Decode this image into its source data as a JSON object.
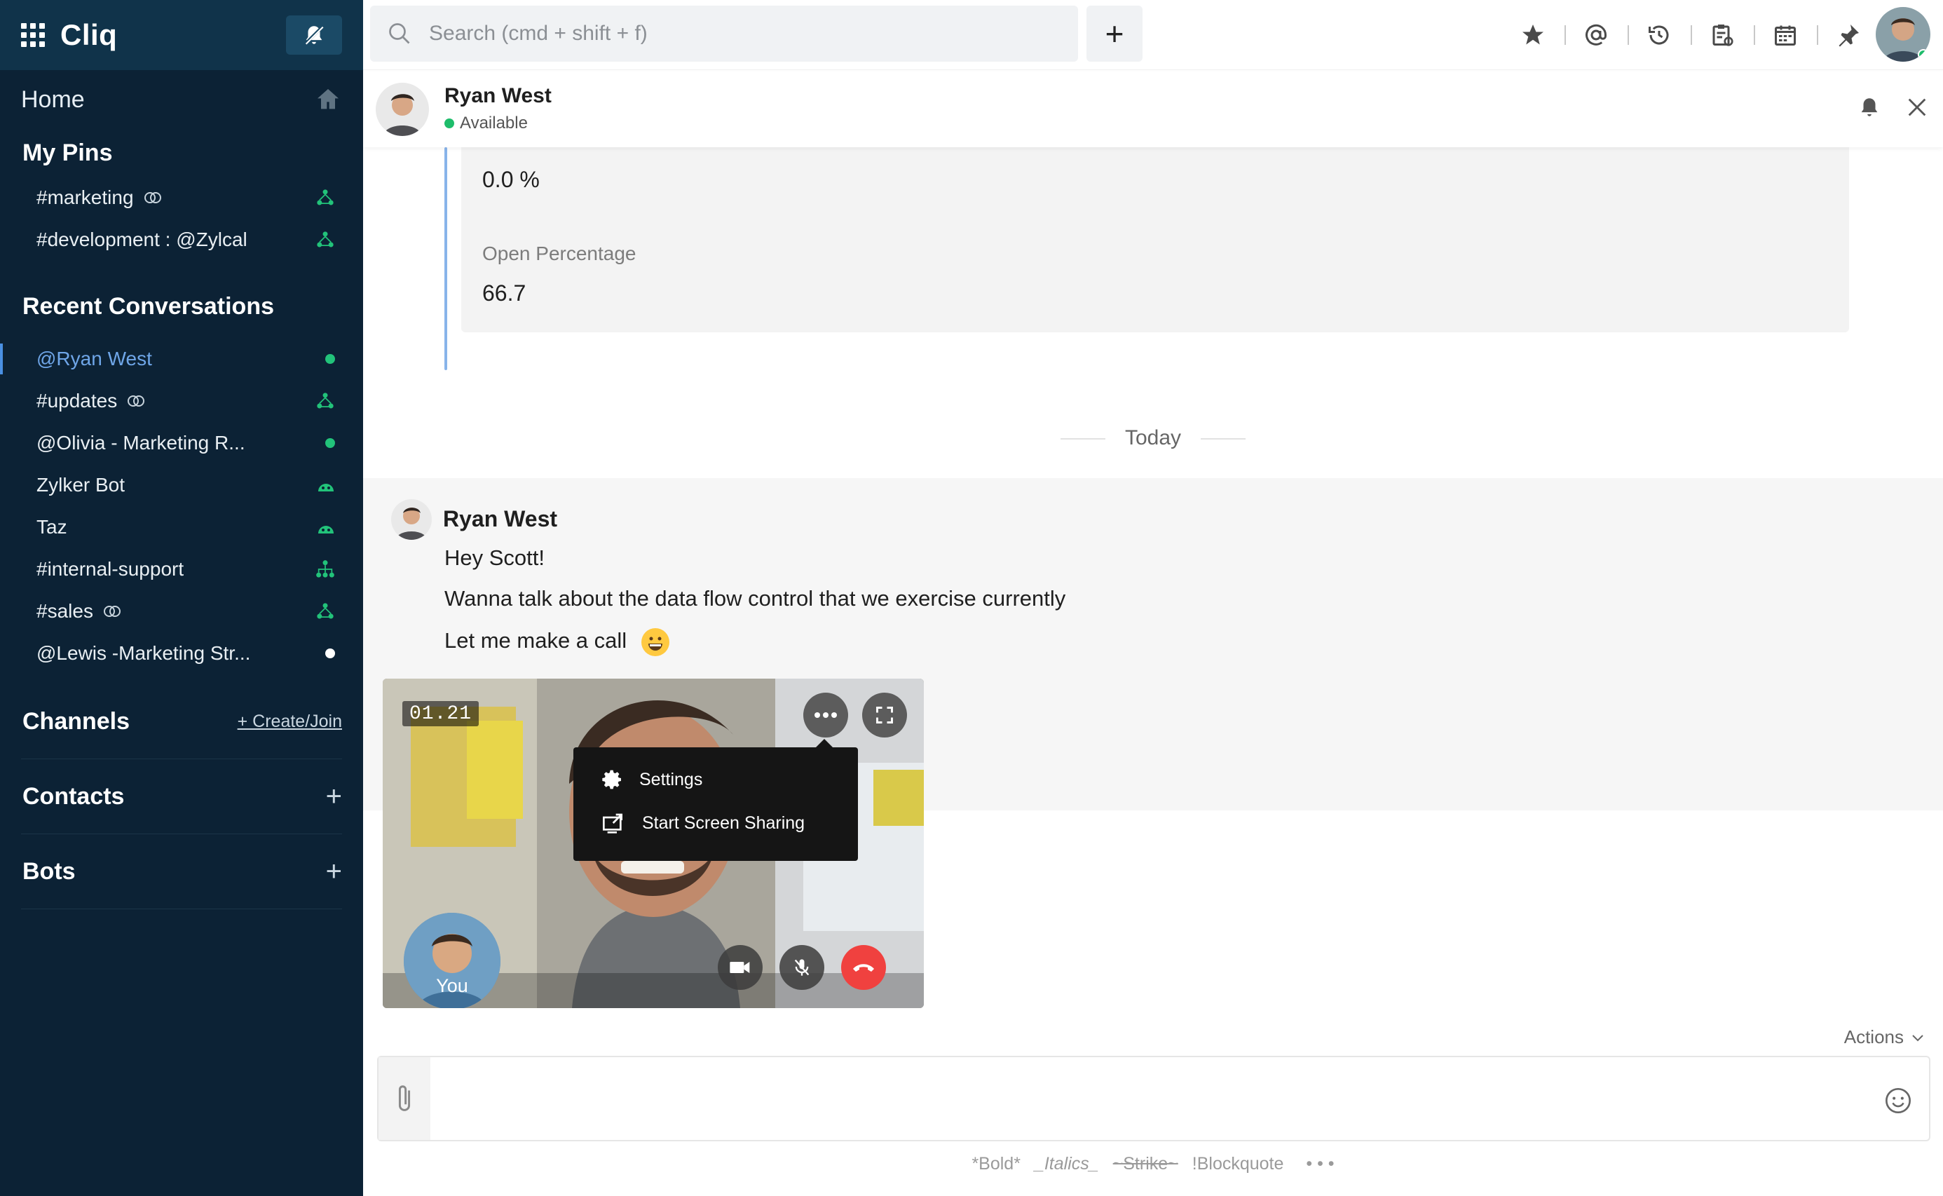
{
  "app": {
    "title": "Cliq"
  },
  "sidebar": {
    "home_label": "Home",
    "pins_title": "My Pins",
    "pins": [
      {
        "label": "#marketing",
        "linked": true
      },
      {
        "label": "#development : @Zylcal",
        "linked": false
      }
    ],
    "recent_title": "Recent Conversations",
    "recent": [
      {
        "label": "@Ryan West",
        "linked": false
      },
      {
        "label": "#updates",
        "linked": true
      },
      {
        "label": "@Olivia - Marketing R...",
        "linked": false
      },
      {
        "label": "Zylker Bot",
        "linked": false
      },
      {
        "label": "Taz",
        "linked": false
      },
      {
        "label": "#internal-support",
        "linked": false
      },
      {
        "label": "#sales",
        "linked": true
      },
      {
        "label": "@Lewis -Marketing Str...",
        "linked": false
      }
    ],
    "channels_label": "Channels",
    "create_join_label": "+ Create/Join",
    "contacts_label": "Contacts",
    "bots_label": "Bots"
  },
  "search": {
    "placeholder": "Search (cmd + shift + f)"
  },
  "top_icons": [
    "star-icon",
    "mention-icon",
    "history-icon",
    "clipboard-icon",
    "calendar-icon",
    "pin-icon"
  ],
  "chat": {
    "contact_name": "Ryan West",
    "contact_status": "Available",
    "card": {
      "value_1": "0.0 %",
      "key_2": "Open Percentage",
      "value_2": "66.7"
    },
    "day_separator": "Today",
    "message": {
      "sender": "Ryan West",
      "lines": [
        "Hey Scott!",
        "Wanna talk about the data flow control that we exercise currently",
        "Let me make a call"
      ]
    },
    "call": {
      "timer": "01.21",
      "menu": {
        "settings": "Settings",
        "screen_share": "Start Screen Sharing"
      },
      "self_label": "You"
    }
  },
  "composer": {
    "actions_label": "Actions",
    "hints": {
      "bold": "*Bold*",
      "italics": "_Italics_",
      "strike": "~Strike~",
      "blockquote": "!Blockquote",
      "more": "• • •"
    }
  },
  "colors": {
    "sidebar_bg": "#0c2235",
    "accent_green": "#1ebd6b",
    "active_link": "#6fa6e8",
    "end_call": "#f0413f"
  }
}
